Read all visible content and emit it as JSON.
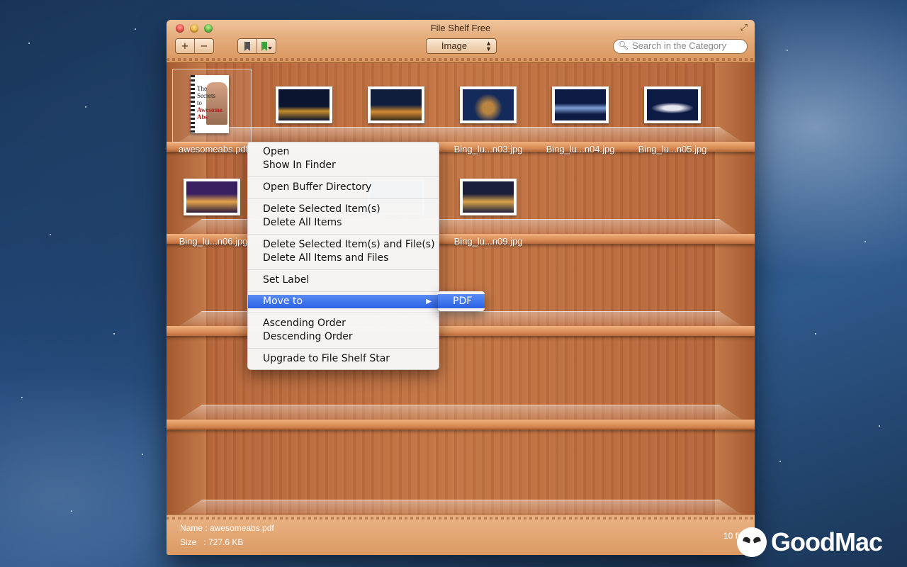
{
  "window": {
    "title": "File Shelf Free",
    "toolbar": {
      "add_label": "+",
      "remove_label": "−",
      "bookmark_icon": "bookmark-icon",
      "bookmark_add_icon": "bookmark-add-icon",
      "category_selected": "Image",
      "search_placeholder": "Search in the Category"
    }
  },
  "shelves": {
    "row1": [
      {
        "name": "awesomeabs.pdf",
        "type": "pdf"
      },
      {
        "name": "",
        "type": "image",
        "colors": [
          "#0b1530",
          "#c58b2c"
        ]
      },
      {
        "name": "",
        "type": "image",
        "colors": [
          "#101d3d",
          "#d28a2f"
        ]
      },
      {
        "name": "Bing_lu...n03.jpg",
        "type": "image",
        "colors": [
          "#142a5a",
          "#b88440"
        ]
      },
      {
        "name": "Bing_lu...n04.jpg",
        "type": "image",
        "colors": [
          "#0c1a44",
          "#7fa0d6"
        ]
      },
      {
        "name": "Bing_lu...n05.jpg",
        "type": "image",
        "colors": [
          "#0c1a44",
          "#e6e6f0"
        ]
      }
    ],
    "row2": [
      {
        "name": "Bing_lu...n06.jpg",
        "type": "image",
        "colors": [
          "#3a2060",
          "#e3a44a"
        ]
      },
      {
        "name": "",
        "type": "image",
        "colors": [
          "#2a3f7a",
          "#d9a56a"
        ]
      },
      {
        "name": "Bing_lu...n09.jpg",
        "type": "image",
        "colors": [
          "#1c1f3c",
          "#d8a24a"
        ]
      }
    ]
  },
  "pdf_cover": {
    "line1": "The",
    "line2": "Secrets",
    "line3": "to",
    "line4": "Awesome",
    "line5": "Abs"
  },
  "context_menu": {
    "items": [
      "Open",
      "Show In Finder",
      "Open Buffer Directory",
      "Delete Selected Item(s)",
      "Delete All Items",
      "Delete Selected Item(s) and File(s)",
      "Delete All Items and Files",
      "Set Label",
      "Move to",
      "Ascending Order",
      "Descending Order",
      "Upgrade to File Shelf Star"
    ],
    "highlighted": "Move to",
    "submenu": [
      "PDF"
    ]
  },
  "footer": {
    "name_line": "Name : awesomeabs.pdf",
    "size_line": "Size   : 727.6 KB",
    "count": "10 file"
  },
  "watermark": {
    "text": "GoodMac"
  }
}
